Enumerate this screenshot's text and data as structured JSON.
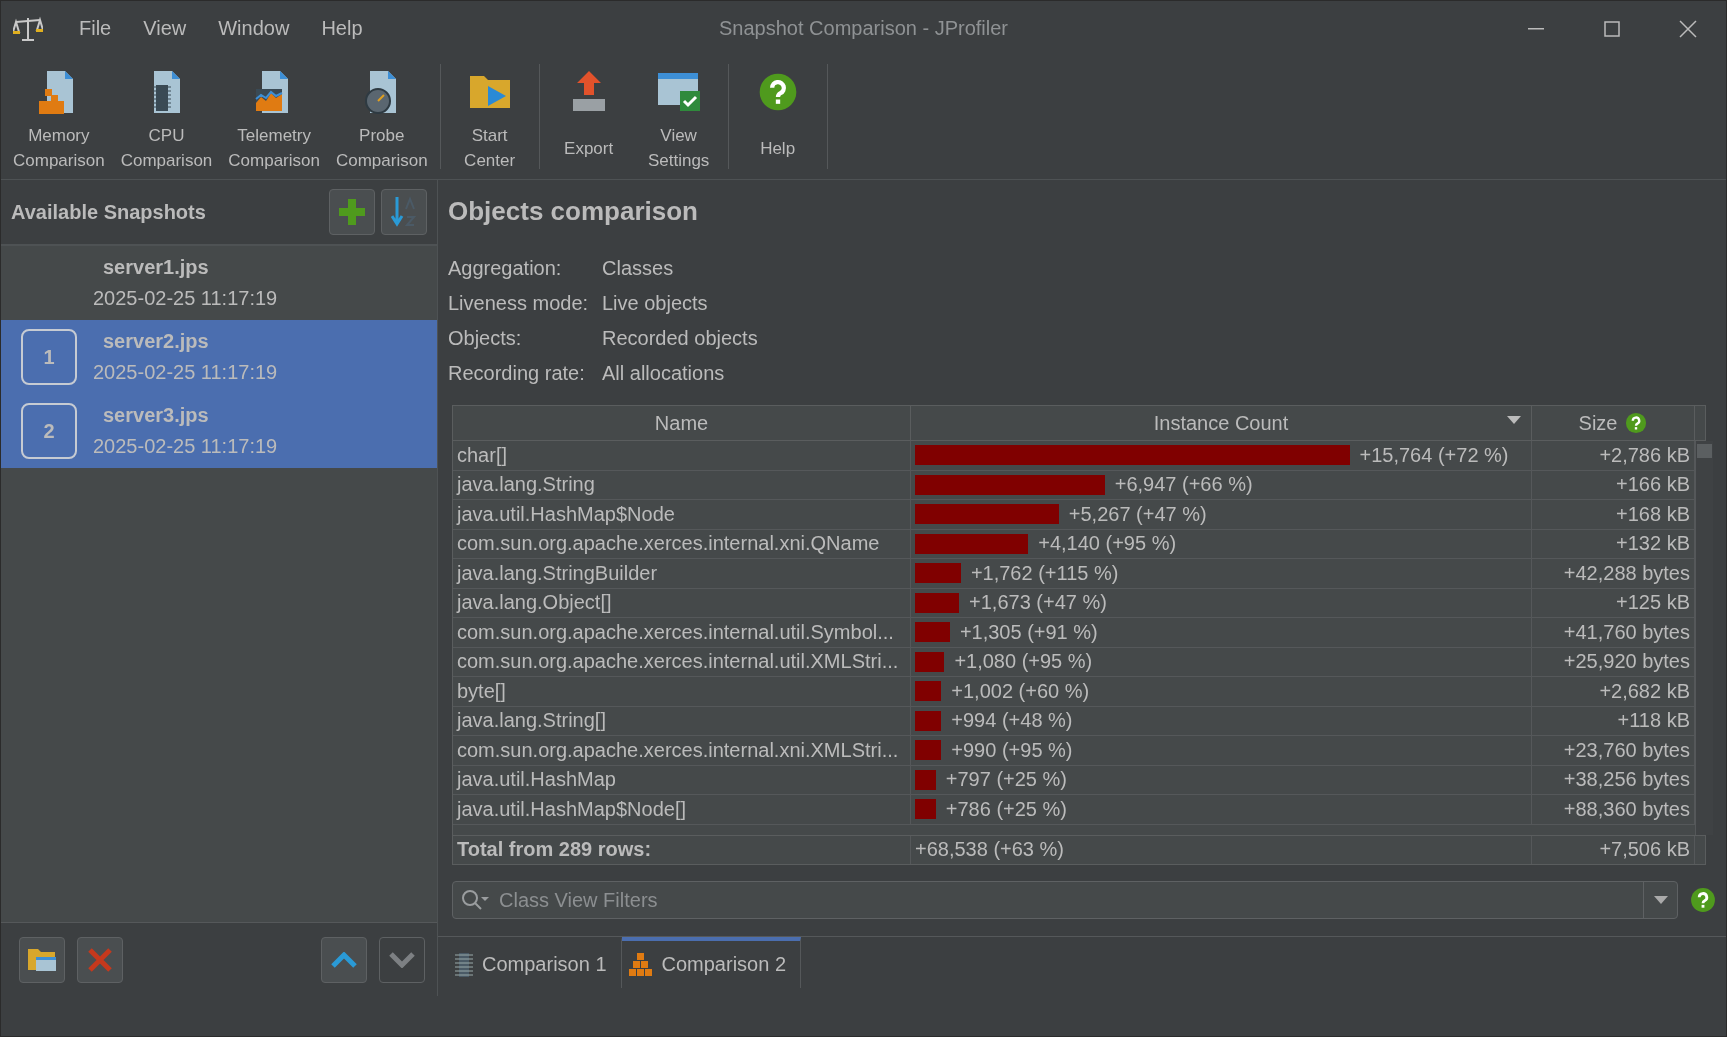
{
  "window": {
    "title": "Snapshot Comparison - JProfiler"
  },
  "menu": [
    "File",
    "View",
    "Window",
    "Help"
  ],
  "toolbar": [
    [
      {
        "lines": [
          "Memory",
          "Comparison"
        ]
      },
      {
        "lines": [
          "CPU",
          "Comparison"
        ]
      },
      {
        "lines": [
          "Telemetry",
          "Comparison"
        ]
      },
      {
        "lines": [
          "Probe",
          "Comparison"
        ]
      }
    ],
    [
      {
        "lines": [
          "Start",
          "Center"
        ]
      }
    ],
    [
      {
        "lines": [
          "Export"
        ]
      },
      {
        "lines": [
          "View",
          "Settings"
        ]
      }
    ],
    [
      {
        "lines": [
          "Help"
        ]
      }
    ]
  ],
  "sidebar": {
    "title": "Available Snapshots",
    "snapshots": [
      {
        "name": "server1.jps",
        "date": "2025-02-25 11:17:19",
        "selected": false
      },
      {
        "name": "server2.jps",
        "date": "2025-02-25 11:17:19",
        "selected": true,
        "badge": "1"
      },
      {
        "name": "server3.jps",
        "date": "2025-02-25 11:17:19",
        "selected": true,
        "badge": "2"
      }
    ]
  },
  "panel": {
    "title": "Objects comparison",
    "properties": [
      {
        "label": "Aggregation:",
        "value": "Classes"
      },
      {
        "label": "Liveness mode:",
        "value": "Live objects"
      },
      {
        "label": "Objects:",
        "value": "Recorded objects"
      },
      {
        "label": "Recording rate:",
        "value": "All allocations"
      }
    ]
  },
  "table": {
    "columns": [
      {
        "label": "Name",
        "sorted": false
      },
      {
        "label": "Instance Count",
        "sorted": true
      },
      {
        "label": "Size",
        "sorted": false
      }
    ],
    "rows": [
      {
        "name": "char[]",
        "count": "+15,764 (+72 %)",
        "level": 0.71,
        "size": "+2,786 kB"
      },
      {
        "name": "java.lang.String",
        "count": "+6,947 (+66 %)",
        "level": 0.31,
        "size": "+166 kB"
      },
      {
        "name": "java.util.HashMap$Node",
        "count": "+5,267 (+47 %)",
        "level": 0.235,
        "size": "+168 kB"
      },
      {
        "name": "com.sun.org.apache.xerces.internal.xni.QName",
        "count": "+4,140 (+95 %)",
        "level": 0.185,
        "size": "+132 kB"
      },
      {
        "name": "java.lang.StringBuilder",
        "count": "+1,762 (+115 %)",
        "level": 0.075,
        "size": "+42,288 bytes"
      },
      {
        "name": "java.lang.Object[]",
        "count": "+1,673 (+47 %)",
        "level": 0.072,
        "size": "+125 kB"
      },
      {
        "name": "com.sun.org.apache.xerces.internal.util.Symbol...",
        "count": "+1,305 (+91 %)",
        "level": 0.057,
        "size": "+41,760 bytes"
      },
      {
        "name": "com.sun.org.apache.xerces.internal.util.XMLStri...",
        "count": "+1,080 (+95 %)",
        "level": 0.048,
        "size": "+25,920 bytes"
      },
      {
        "name": "byte[]",
        "count": "+1,002 (+60 %)",
        "level": 0.043,
        "size": "+2,682 kB"
      },
      {
        "name": "java.lang.String[]",
        "count": "+994 (+48 %)",
        "level": 0.043,
        "size": "+118 kB"
      },
      {
        "name": "com.sun.org.apache.xerces.internal.xni.XMLStri...",
        "count": "+990 (+95 %)",
        "level": 0.043,
        "size": "+23,760 bytes"
      },
      {
        "name": "java.util.HashMap",
        "count": "+797 (+25 %)",
        "level": 0.034,
        "size": "+38,256 bytes"
      },
      {
        "name": "java.util.HashMap$Node[]",
        "count": "+786 (+25 %)",
        "level": 0.034,
        "size": "+88,360 bytes"
      }
    ],
    "total": {
      "label": "Total from 289 rows:",
      "count": "+68,538 (+63 %)",
      "size": "+7,506 kB"
    }
  },
  "filter": {
    "placeholder": "Class View Filters"
  },
  "tabs": [
    {
      "label": "Comparison 1",
      "selected": false
    },
    {
      "label": "Comparison 2",
      "selected": true
    }
  ]
}
